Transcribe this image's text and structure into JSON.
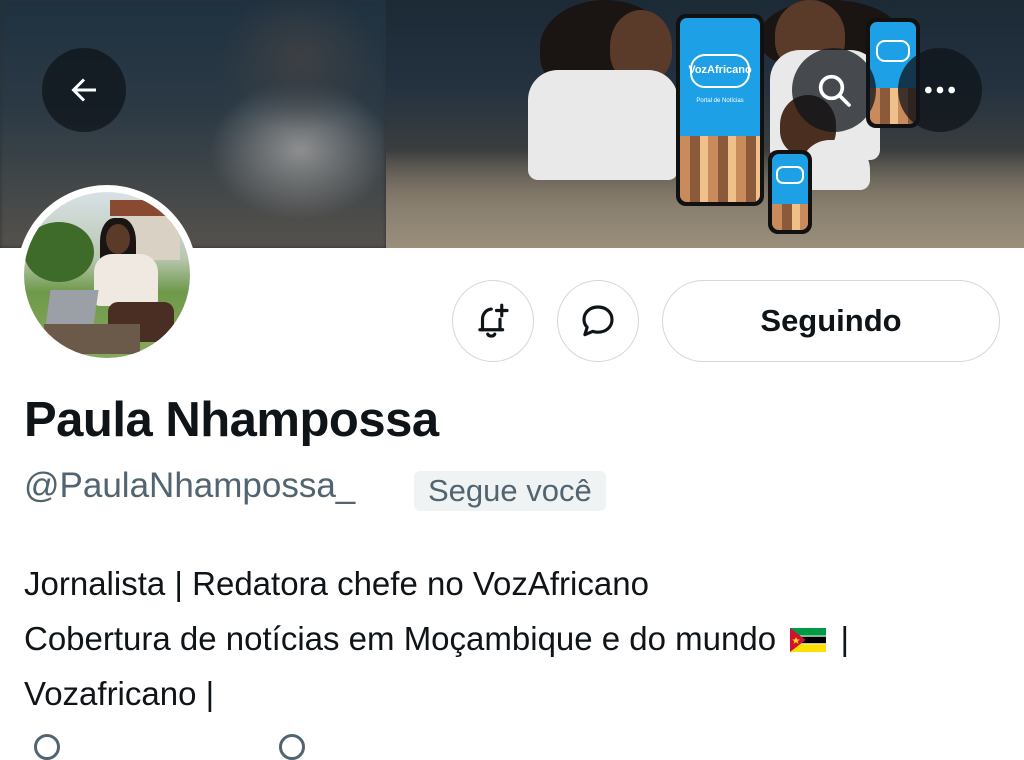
{
  "profile": {
    "display_name": "Paula Nhampossa",
    "handle": "@PaulaNhampossa_",
    "follows_you_badge": "Segue você",
    "bio_lines": [
      "Jornalista | Redatora chefe no VozAfricano",
      "Cobertura de notícias em Moçambique e do mundo",
      " |",
      "Vozafricano |"
    ]
  },
  "banner": {
    "app_brand": "VozAfricano",
    "app_tagline": "Portal de Notícias"
  },
  "actions": {
    "following_label": "Seguindo"
  },
  "icons": {
    "back": "arrow-left-icon",
    "search": "search-icon",
    "more": "more-horizontal-icon",
    "notify": "bell-plus-icon",
    "message": "chat-bubble-icon",
    "flag": "mozambique-flag-icon"
  },
  "colors": {
    "text_primary": "#0f1419",
    "text_secondary": "#536471",
    "border": "#cfd9de",
    "badge_bg": "#eff3f4",
    "brand_blue": "#1ea0e6"
  }
}
